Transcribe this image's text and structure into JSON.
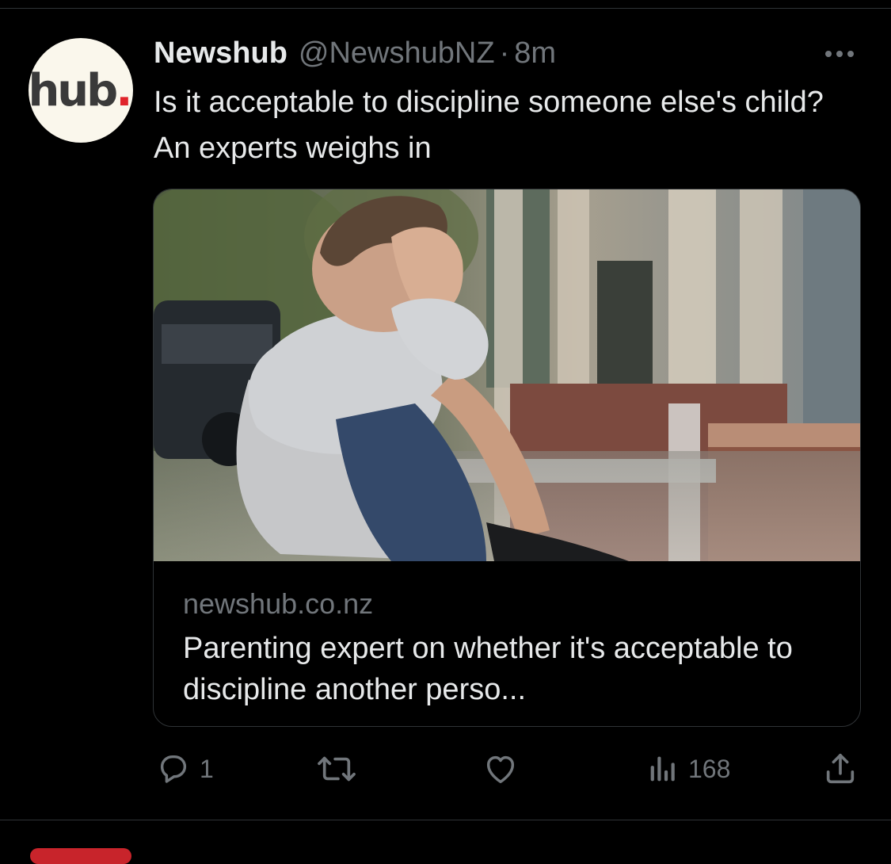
{
  "tweet": {
    "avatar_text": "hub",
    "avatar_dot": ".",
    "display_name": "Newshub",
    "handle": "@NewshubNZ",
    "separator": "·",
    "time": "8m",
    "text": "Is it acceptable to discipline someone else's child? An experts weighs in"
  },
  "card": {
    "domain": "newshub.co.nz",
    "title": "Parenting expert on whether it's acceptable to discipline another perso..."
  },
  "actions": {
    "reply_count": "1",
    "retweet_count": "",
    "like_count": "",
    "views_count": "168"
  },
  "icons": {
    "more": "more-horizontal-icon",
    "reply": "reply-icon",
    "retweet": "retweet-icon",
    "like": "heart-icon",
    "views": "views-icon",
    "share": "share-icon"
  },
  "colors": {
    "background": "#000000",
    "text": "#e7e9ea",
    "secondary_text": "#71767b",
    "divider": "#2f3336",
    "brand_dot": "#e0242b"
  }
}
